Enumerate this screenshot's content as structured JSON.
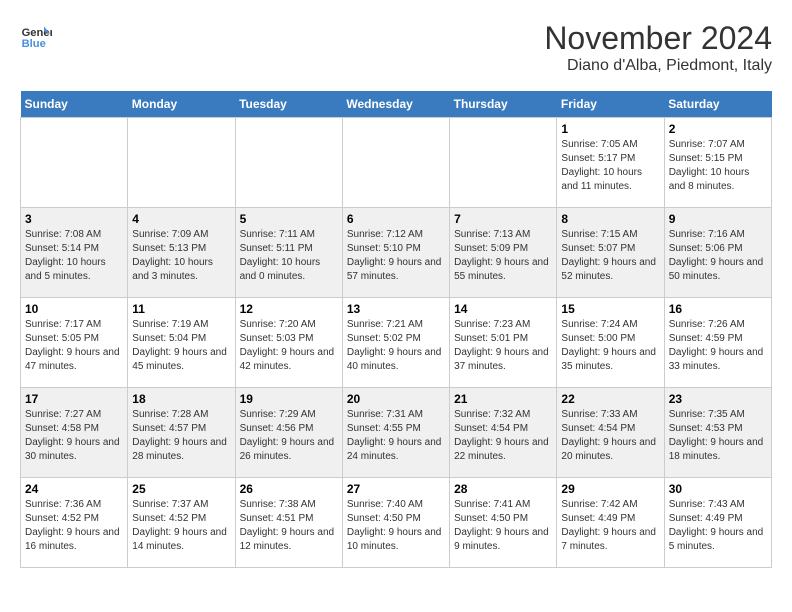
{
  "header": {
    "logo_line1": "General",
    "logo_line2": "Blue",
    "month": "November 2024",
    "location": "Diano d'Alba, Piedmont, Italy"
  },
  "weekdays": [
    "Sunday",
    "Monday",
    "Tuesday",
    "Wednesday",
    "Thursday",
    "Friday",
    "Saturday"
  ],
  "weeks": [
    [
      {
        "day": "",
        "info": ""
      },
      {
        "day": "",
        "info": ""
      },
      {
        "day": "",
        "info": ""
      },
      {
        "day": "",
        "info": ""
      },
      {
        "day": "",
        "info": ""
      },
      {
        "day": "1",
        "info": "Sunrise: 7:05 AM\nSunset: 5:17 PM\nDaylight: 10 hours and 11 minutes."
      },
      {
        "day": "2",
        "info": "Sunrise: 7:07 AM\nSunset: 5:15 PM\nDaylight: 10 hours and 8 minutes."
      }
    ],
    [
      {
        "day": "3",
        "info": "Sunrise: 7:08 AM\nSunset: 5:14 PM\nDaylight: 10 hours and 5 minutes."
      },
      {
        "day": "4",
        "info": "Sunrise: 7:09 AM\nSunset: 5:13 PM\nDaylight: 10 hours and 3 minutes."
      },
      {
        "day": "5",
        "info": "Sunrise: 7:11 AM\nSunset: 5:11 PM\nDaylight: 10 hours and 0 minutes."
      },
      {
        "day": "6",
        "info": "Sunrise: 7:12 AM\nSunset: 5:10 PM\nDaylight: 9 hours and 57 minutes."
      },
      {
        "day": "7",
        "info": "Sunrise: 7:13 AM\nSunset: 5:09 PM\nDaylight: 9 hours and 55 minutes."
      },
      {
        "day": "8",
        "info": "Sunrise: 7:15 AM\nSunset: 5:07 PM\nDaylight: 9 hours and 52 minutes."
      },
      {
        "day": "9",
        "info": "Sunrise: 7:16 AM\nSunset: 5:06 PM\nDaylight: 9 hours and 50 minutes."
      }
    ],
    [
      {
        "day": "10",
        "info": "Sunrise: 7:17 AM\nSunset: 5:05 PM\nDaylight: 9 hours and 47 minutes."
      },
      {
        "day": "11",
        "info": "Sunrise: 7:19 AM\nSunset: 5:04 PM\nDaylight: 9 hours and 45 minutes."
      },
      {
        "day": "12",
        "info": "Sunrise: 7:20 AM\nSunset: 5:03 PM\nDaylight: 9 hours and 42 minutes."
      },
      {
        "day": "13",
        "info": "Sunrise: 7:21 AM\nSunset: 5:02 PM\nDaylight: 9 hours and 40 minutes."
      },
      {
        "day": "14",
        "info": "Sunrise: 7:23 AM\nSunset: 5:01 PM\nDaylight: 9 hours and 37 minutes."
      },
      {
        "day": "15",
        "info": "Sunrise: 7:24 AM\nSunset: 5:00 PM\nDaylight: 9 hours and 35 minutes."
      },
      {
        "day": "16",
        "info": "Sunrise: 7:26 AM\nSunset: 4:59 PM\nDaylight: 9 hours and 33 minutes."
      }
    ],
    [
      {
        "day": "17",
        "info": "Sunrise: 7:27 AM\nSunset: 4:58 PM\nDaylight: 9 hours and 30 minutes."
      },
      {
        "day": "18",
        "info": "Sunrise: 7:28 AM\nSunset: 4:57 PM\nDaylight: 9 hours and 28 minutes."
      },
      {
        "day": "19",
        "info": "Sunrise: 7:29 AM\nSunset: 4:56 PM\nDaylight: 9 hours and 26 minutes."
      },
      {
        "day": "20",
        "info": "Sunrise: 7:31 AM\nSunset: 4:55 PM\nDaylight: 9 hours and 24 minutes."
      },
      {
        "day": "21",
        "info": "Sunrise: 7:32 AM\nSunset: 4:54 PM\nDaylight: 9 hours and 22 minutes."
      },
      {
        "day": "22",
        "info": "Sunrise: 7:33 AM\nSunset: 4:54 PM\nDaylight: 9 hours and 20 minutes."
      },
      {
        "day": "23",
        "info": "Sunrise: 7:35 AM\nSunset: 4:53 PM\nDaylight: 9 hours and 18 minutes."
      }
    ],
    [
      {
        "day": "24",
        "info": "Sunrise: 7:36 AM\nSunset: 4:52 PM\nDaylight: 9 hours and 16 minutes."
      },
      {
        "day": "25",
        "info": "Sunrise: 7:37 AM\nSunset: 4:52 PM\nDaylight: 9 hours and 14 minutes."
      },
      {
        "day": "26",
        "info": "Sunrise: 7:38 AM\nSunset: 4:51 PM\nDaylight: 9 hours and 12 minutes."
      },
      {
        "day": "27",
        "info": "Sunrise: 7:40 AM\nSunset: 4:50 PM\nDaylight: 9 hours and 10 minutes."
      },
      {
        "day": "28",
        "info": "Sunrise: 7:41 AM\nSunset: 4:50 PM\nDaylight: 9 hours and 9 minutes."
      },
      {
        "day": "29",
        "info": "Sunrise: 7:42 AM\nSunset: 4:49 PM\nDaylight: 9 hours and 7 minutes."
      },
      {
        "day": "30",
        "info": "Sunrise: 7:43 AM\nSunset: 4:49 PM\nDaylight: 9 hours and 5 minutes."
      }
    ]
  ]
}
